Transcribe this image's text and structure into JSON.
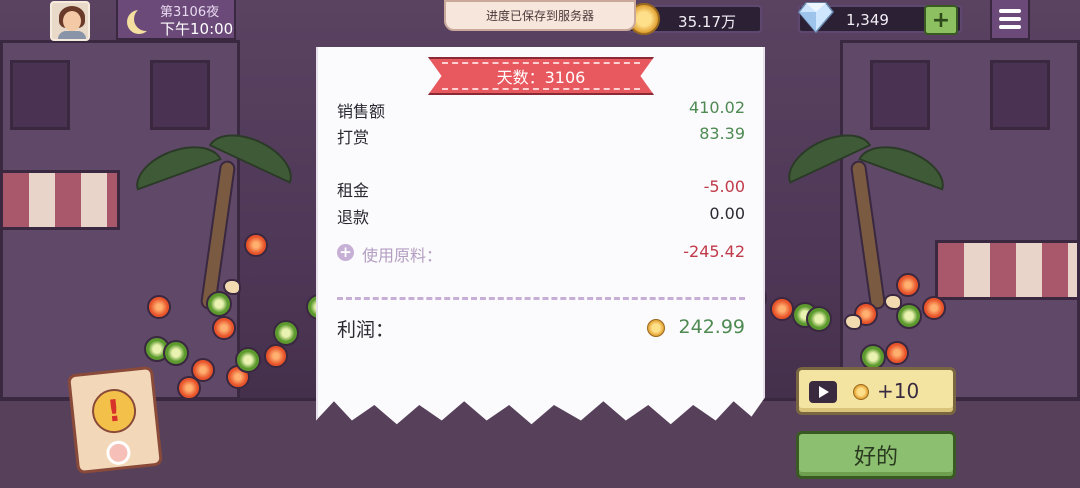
{
  "status_bar": {
    "night_label": "第3106夜",
    "time_label": "下午10:00",
    "save_toast": "进度已保存到服务器",
    "coins": "35.17万",
    "gems": "1,349",
    "gem_plus": "+"
  },
  "receipt": {
    "day_banner": "天数：3106",
    "sales_label": "销售额",
    "sales_value": "410.02",
    "tips_label": "打赏",
    "tips_value": "83.39",
    "rent_label": "租金",
    "rent_value": "-5.00",
    "refund_label": "退款",
    "refund_value": "0.00",
    "ingredients_label": "使用原料：",
    "ingredients_value": "-245.42",
    "profit_label": "利润：",
    "profit_value": "242.99"
  },
  "buttons": {
    "ad_reward": "+10",
    "ok": "好的"
  },
  "alert": {
    "symbol": "!"
  },
  "colors": {
    "positive": "#4e8a52",
    "negative": "#c03a4a",
    "banner": "#e8585f",
    "ok_button": "#8cc070",
    "ad_button": "#f3e4a2"
  }
}
